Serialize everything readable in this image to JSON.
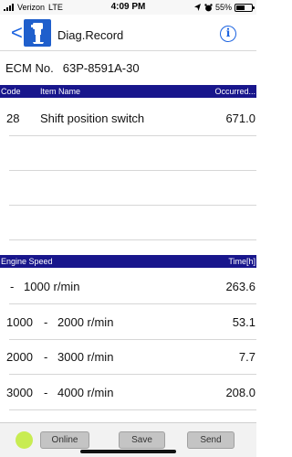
{
  "status_bar": {
    "carrier": "Verizon",
    "network": "LTE",
    "time": "4:09 PM",
    "battery": "55%",
    "battery_level": 0.55,
    "icons": [
      "signal-icon",
      "location-icon",
      "alarm-icon",
      "battery-icon"
    ]
  },
  "nav": {
    "back": "<",
    "title": "Diag.Record",
    "info": "i",
    "logo": "engine-logo"
  },
  "ecm": {
    "label": "ECM No.",
    "value": "63P-8591A-30"
  },
  "diag_table": {
    "headers": {
      "code": "Code",
      "item": "Item Name",
      "occurred": "Occurred..."
    },
    "rows": [
      {
        "code": "28",
        "item": "Shift position switch",
        "occurred": "671.0"
      }
    ]
  },
  "speed_table": {
    "headers": {
      "speed": "Engine Speed",
      "time": "Time[h]"
    },
    "rows": [
      {
        "from": "",
        "sep": "-",
        "to": "1000 r/min",
        "time": "263.6"
      },
      {
        "from": "1000",
        "sep": "-",
        "to": "2000 r/min",
        "time": "53.1"
      },
      {
        "from": "2000",
        "sep": "-",
        "to": "3000 r/min",
        "time": "7.7"
      },
      {
        "from": "3000",
        "sep": "-",
        "to": "4000 r/min",
        "time": "208.0"
      }
    ]
  },
  "bottom": {
    "status_color": "#c8ec52",
    "online": "Online",
    "save": "Save",
    "send": "Send"
  },
  "colors": {
    "header_bg": "#18168c",
    "accent": "#1a62e0"
  }
}
